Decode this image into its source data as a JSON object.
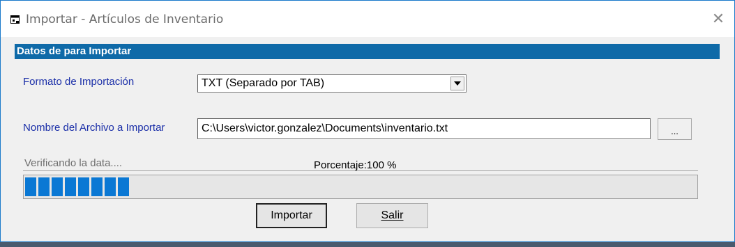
{
  "window": {
    "title": "Importar - Artículos de Inventario",
    "close_glyph": "✕"
  },
  "section": {
    "header": "Datos de para  Importar"
  },
  "format": {
    "label": "Formato de Importación",
    "selected": "TXT (Separado por TAB)"
  },
  "file": {
    "label": "Nombre del Archivo a Importar",
    "value": "C:\\Users\\victor.gonzalez\\Documents\\inventario.txt",
    "browse_label": "..."
  },
  "progress": {
    "status": "Verificando la data....",
    "percent_label": "Porcentaje:100 %",
    "visible_segments": 8
  },
  "buttons": {
    "import": "Importar",
    "exit": "Salir"
  },
  "colors": {
    "header_bg": "#0f6aa8",
    "label_text": "#1a2ea8",
    "progress_fill": "#0a78d4"
  },
  "icons": {
    "window": "form-window-icon",
    "dropdown": "dropdown-arrow-icon"
  }
}
